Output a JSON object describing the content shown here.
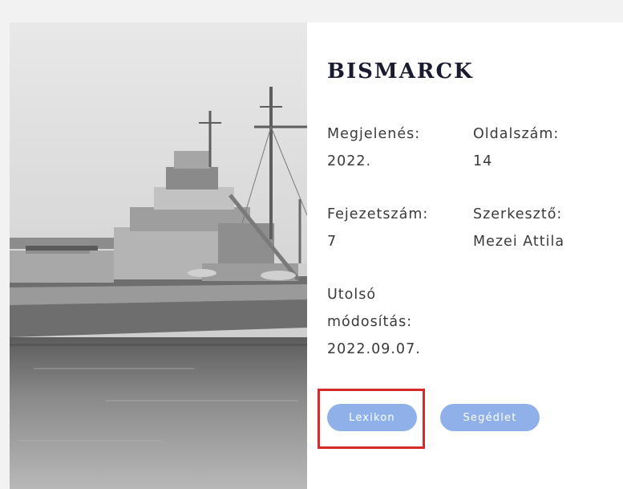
{
  "book": {
    "title": "BISMARCK"
  },
  "fields": {
    "megjelenes": {
      "label": "Megjelenés:",
      "value": "2022."
    },
    "oldalszam": {
      "label": "Oldalszám:",
      "value": "14"
    },
    "fejezetszam": {
      "label": "Fejezetszám:",
      "value": "7"
    },
    "szerkeszto": {
      "label": "Szerkesztő:",
      "value": "Mezei Attila"
    },
    "utolso_modositas": {
      "label_line1": "Utolsó",
      "label_line2": "módosítás:",
      "value": "2022.09.07."
    }
  },
  "buttons": {
    "lexikon": "Lexikon",
    "segedlet": "Segédlet"
  },
  "colors": {
    "button_bg": "#8fb0e8",
    "highlight_border": "#d42a2a",
    "title": "#1b1b2f"
  },
  "icons": {
    "photo": "battleship-photo"
  }
}
